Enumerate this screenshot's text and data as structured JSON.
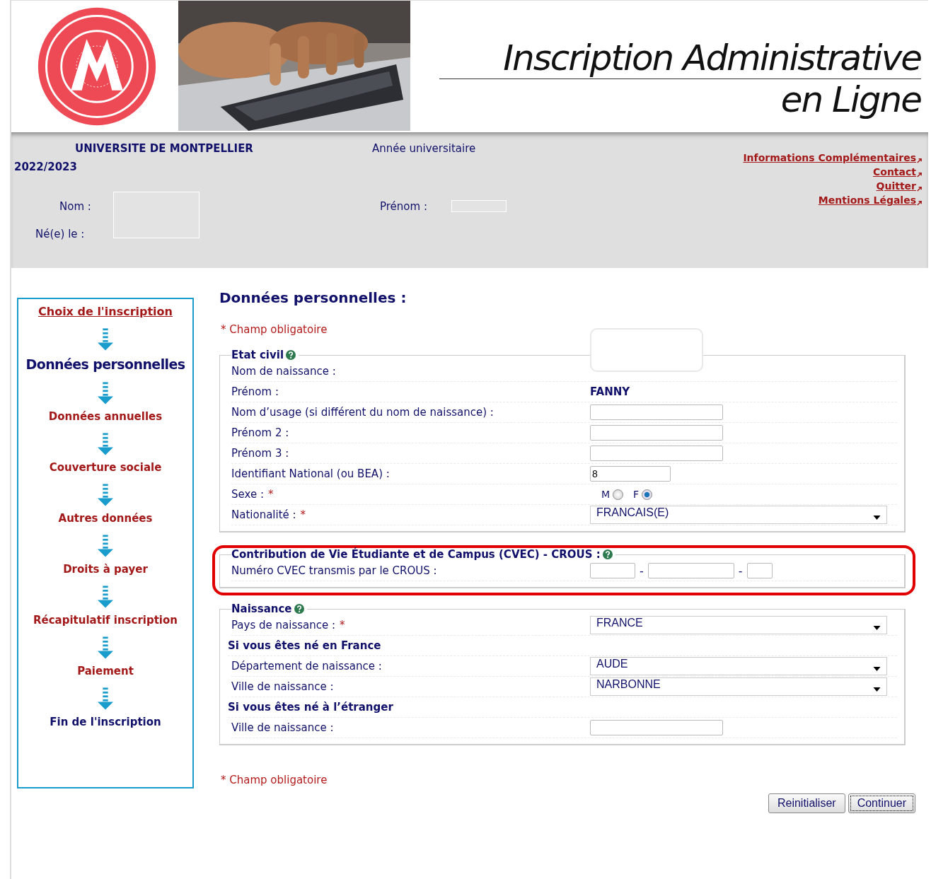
{
  "banner": {
    "title_lines": [
      "Inscription Administrative",
      "en Ligne"
    ]
  },
  "header": {
    "university": "UNIVERSITE DE MONTPELLIER",
    "year_label": "Année universitaire",
    "year": "2022/2023",
    "name_label": "Nom :",
    "birth_label": "Né(e) le :",
    "firstname_label": "Prénom :",
    "links": [
      "Informations Complémentaires",
      "Contact",
      "Quitter",
      "Mentions Légales"
    ]
  },
  "steps": [
    {
      "label": "Choix de l'inscription",
      "kind": "link"
    },
    {
      "label": "Données personnelles",
      "kind": "current"
    },
    {
      "label": "Données annuelles",
      "kind": "todo"
    },
    {
      "label": "Couverture sociale",
      "kind": "todo"
    },
    {
      "label": "Autres données",
      "kind": "todo"
    },
    {
      "label": "Droits à payer",
      "kind": "todo"
    },
    {
      "label": "Récapitulatif inscription",
      "kind": "todo"
    },
    {
      "label": "Paiement",
      "kind": "todo"
    },
    {
      "label": "Fin de l'inscription",
      "kind": "end"
    }
  ],
  "main": {
    "title": "Données personnelles :",
    "required_note_top": "* Champ obligatoire",
    "required_note_bottom": "* Champ obligatoire",
    "sections": [
      {
        "title": "Etat civil",
        "highlighted": false,
        "rows": [
          {
            "label": "Nom de naissance :",
            "kind": "hidden",
            "required": false
          },
          {
            "label": "Prénom :",
            "kind": "text",
            "value": "FANNY",
            "required": false
          },
          {
            "label": "Nom d’usage (si différent du nom de naissance) :",
            "kind": "input",
            "required": false
          },
          {
            "label": "Prénom 2 :",
            "kind": "input",
            "required": false
          },
          {
            "label": "Prénom 3 :",
            "kind": "input",
            "required": false
          },
          {
            "label": "Identifiant National (ou BEA) :",
            "kind": "masked_input",
            "value": "8",
            "required": false
          },
          {
            "label": "Sexe :",
            "kind": "radio",
            "required": true,
            "options": [
              {
                "label": "M",
                "selected": false
              },
              {
                "label": "F",
                "selected": true
              }
            ]
          },
          {
            "label": "Nationalité :",
            "kind": "select",
            "value": "FRANCAIS(E)",
            "required": true
          }
        ]
      },
      {
        "title": "Contribution de Vie Étudiante et de Campus (CVEC) - CROUS :",
        "highlighted": true,
        "rows": [
          {
            "label": "Numéro CVEC transmis par le CROUS :",
            "kind": "code_input",
            "separators": [
              "-",
              "-"
            ],
            "required": false
          }
        ]
      },
      {
        "title": "Naissance",
        "highlighted": false,
        "rows": [
          {
            "label": "Pays de naissance :",
            "kind": "select",
            "value": "FRANCE",
            "required": true
          },
          {
            "label": "Si vous êtes né en France",
            "kind": "subheading"
          },
          {
            "label": "Département de naissance :",
            "kind": "select",
            "value": "AUDE",
            "required": false
          },
          {
            "label": "Ville de naissance :",
            "kind": "select",
            "value": "NARBONNE",
            "required": false
          },
          {
            "label": "Si vous êtes né à l’étranger",
            "kind": "subheading"
          },
          {
            "label": "Ville de naissance :",
            "kind": "input",
            "required": false
          }
        ]
      }
    ],
    "required_star": "*",
    "buttons": [
      {
        "label": "Reinitialiser",
        "focused": false
      },
      {
        "label": "Continuer",
        "focused": true
      }
    ]
  }
}
